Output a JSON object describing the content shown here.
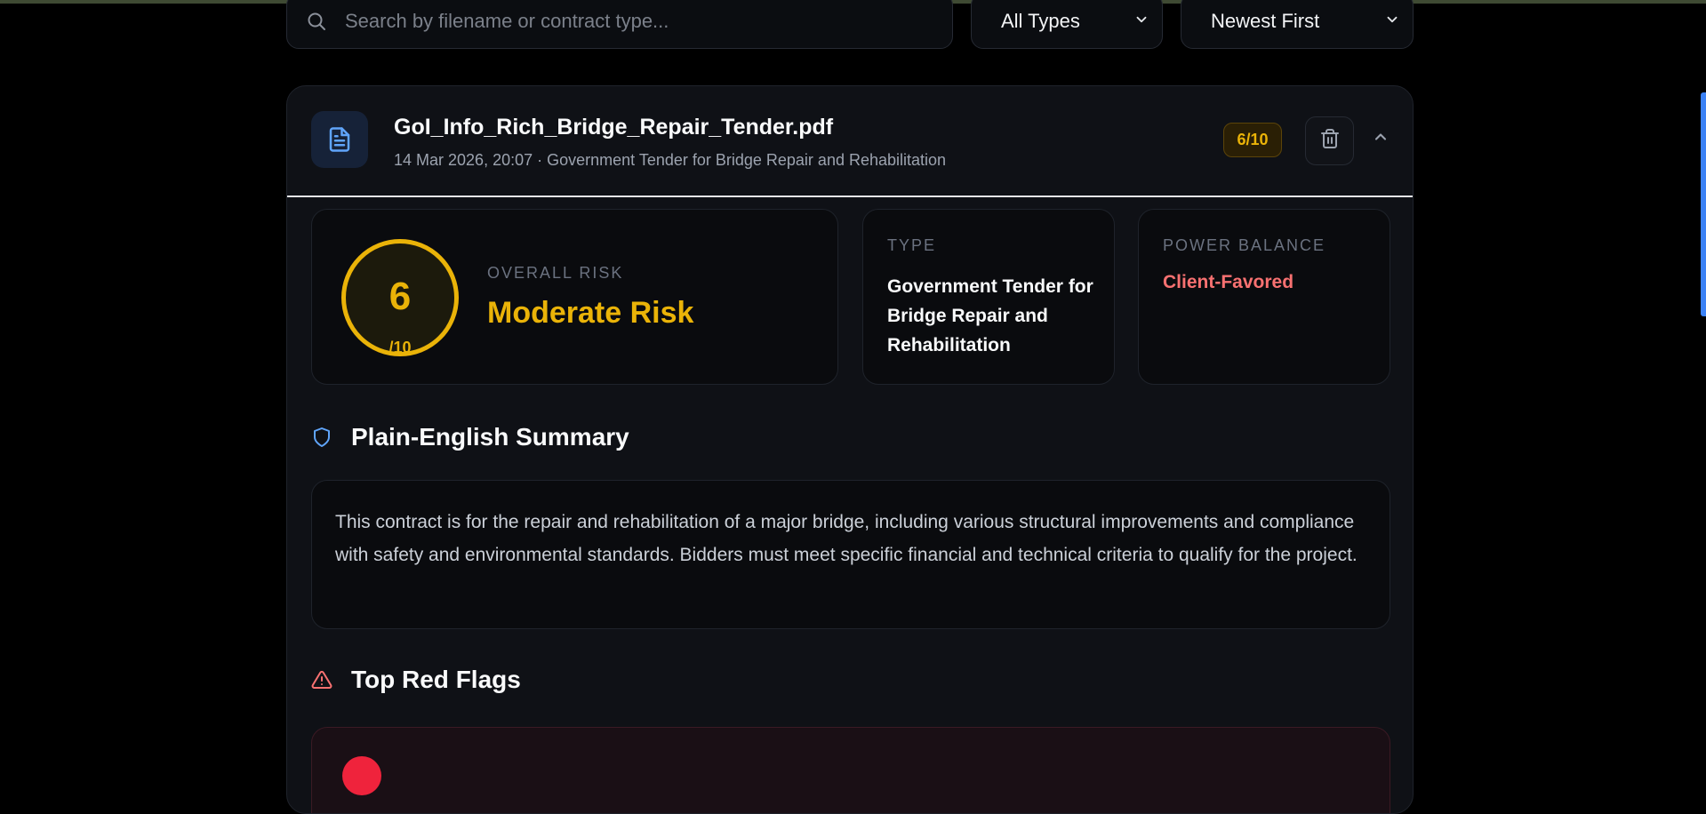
{
  "toolbar": {
    "search_placeholder": "Search by filename or contract type...",
    "type_filter": "All Types",
    "sort": "Newest First"
  },
  "document": {
    "file_name": "GoI_Info_Rich_Bridge_Repair_Tender.pdf",
    "meta": "14 Mar 2026, 20:07 · Government Tender for Bridge Repair and Rehabilitation",
    "score_badge": "6/10"
  },
  "stats": {
    "risk": {
      "score": "6",
      "out_of": "/10",
      "label": "OVERALL RISK",
      "level": "Moderate Risk",
      "fraction": 0.6
    },
    "type": {
      "label": "TYPE",
      "value": "Government Tender for Bridge Repair and Rehabilitation"
    },
    "power_balance": {
      "label": "POWER BALANCE",
      "value": "Client-Favored"
    }
  },
  "summary": {
    "title": "Plain-English Summary",
    "text": "This contract is for the repair and rehabilitation of a major bridge, including various structural improvements and compliance with safety and environmental standards. Bidders must meet specific financial and technical criteria to qualify for the project."
  },
  "red_flags": {
    "title": "Top Red Flags"
  },
  "colors": {
    "accent_blue": "#3b82f6",
    "risk_yellow": "#eab308",
    "danger_red": "#f87171",
    "flag_dot_red": "#ef233c"
  },
  "icons": {
    "search": "search-icon",
    "file": "file-text-icon",
    "delete": "trash-icon",
    "collapse": "chevron-up-icon",
    "dropdown": "chevron-down-icon",
    "summary": "shield-icon",
    "red_flags": "warning-triangle-icon"
  }
}
